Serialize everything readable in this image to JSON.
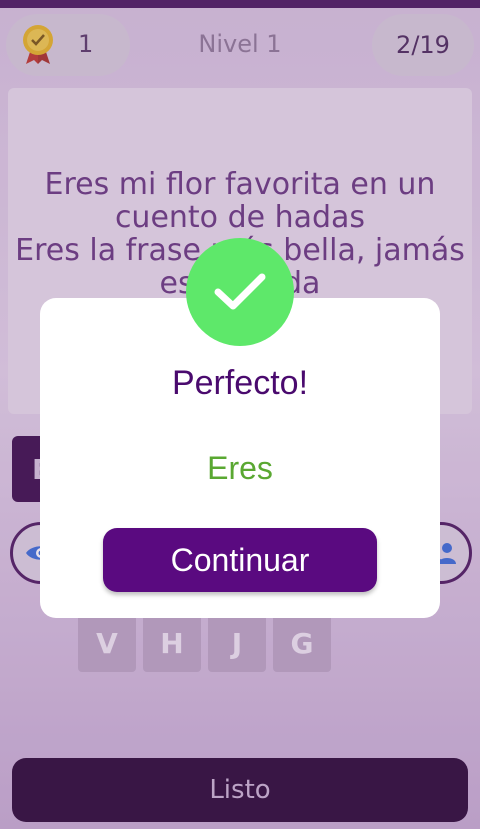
{
  "header": {
    "score": "1",
    "level_title": "Nivel 1",
    "progress": "2/19"
  },
  "verse": {
    "lines": [
      "Eres mi flor favorita en un",
      "cuento de hadas",
      "Eres la frase más bella, jamás",
      "escuchada"
    ]
  },
  "answer": {
    "first_slot": "E"
  },
  "hints": {
    "left_icon": "eye-icon",
    "right_icon": "people-icon"
  },
  "keyboard": {
    "keys": [
      "V",
      "H",
      "J",
      "G"
    ]
  },
  "footer": {
    "done_label": "Listo"
  },
  "dialog": {
    "title": "Perfecto!",
    "word": "Eres",
    "continue_label": "Continuar",
    "icon": "check-icon"
  },
  "colors": {
    "accent": "#5a0a80",
    "success": "#5ee86a",
    "word_green": "#5aa832"
  }
}
